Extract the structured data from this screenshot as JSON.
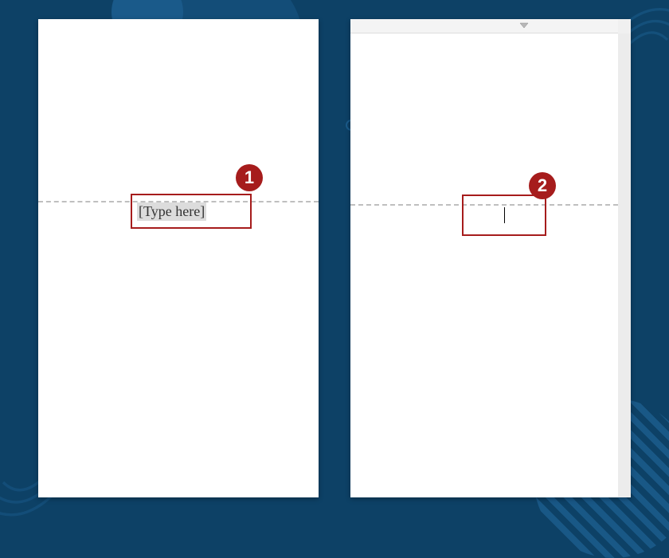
{
  "callouts": {
    "left": {
      "number": "1"
    },
    "right": {
      "number": "2"
    }
  },
  "left_page": {
    "header_placeholder": "[Type here]"
  },
  "right_page": {
    "header_value": ""
  },
  "colors": {
    "accent": "#a61c1c",
    "background": "#0d4166"
  }
}
